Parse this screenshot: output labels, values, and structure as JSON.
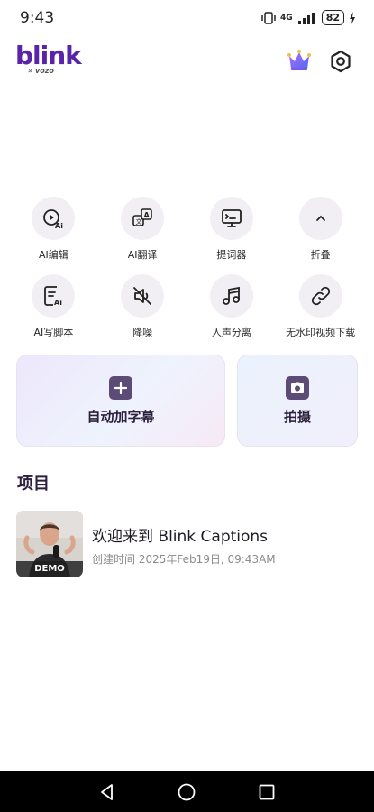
{
  "status": {
    "time": "9:43",
    "network": "4G",
    "battery": "82"
  },
  "header": {
    "logo_main": "blink",
    "logo_sub": "vozo",
    "crown_icon": "crown-icon",
    "settings_icon": "gear-icon"
  },
  "tools": [
    {
      "label": "AI编辑",
      "icon": "ai-edit-icon"
    },
    {
      "label": "AI翻译",
      "icon": "translate-icon"
    },
    {
      "label": "提词器",
      "icon": "teleprompter-icon"
    },
    {
      "label": "折叠",
      "icon": "chevron-up-icon"
    },
    {
      "label": "AI写脚本",
      "icon": "ai-script-icon"
    },
    {
      "label": "降噪",
      "icon": "mute-icon"
    },
    {
      "label": "人声分离",
      "icon": "music-note-icon"
    },
    {
      "label": "无水印视频下载",
      "icon": "link-icon"
    }
  ],
  "cards": {
    "captions_label": "自动加字幕",
    "shoot_label": "拍摄"
  },
  "projects_section": {
    "title": "项目",
    "items": [
      {
        "title": "欢迎来到 Blink Captions",
        "meta": "创建时间 2025年Feb19日, 09:43AM",
        "badge": "DEMO"
      }
    ]
  },
  "colors": {
    "brand": "#5a24a8",
    "card_icon": "#5c4b76",
    "tool_bg": "#f1eff4"
  }
}
